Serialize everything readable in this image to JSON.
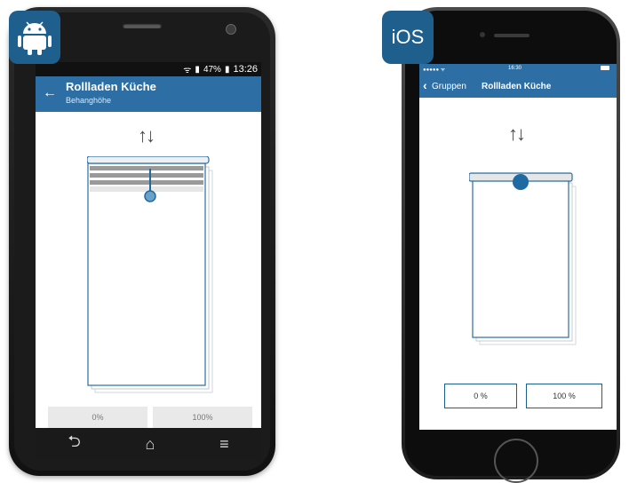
{
  "badges": {
    "android_icon": "android-robot-icon",
    "ios_label": "iOS"
  },
  "android": {
    "status": {
      "battery": "47%",
      "time": "13:26"
    },
    "title": "Rollladen Küche",
    "subtitle": "Behanghöhe",
    "arrows": "↑↓",
    "buttons": {
      "zero": "0%",
      "hundred": "100%"
    },
    "nav_icons": [
      "back-icon",
      "home-icon",
      "menu-icon"
    ],
    "shutter_level": 0.15
  },
  "ios": {
    "status": {
      "carrier": "●●●●● ᯤ",
      "time": "16:30"
    },
    "back_label": "Gruppen",
    "title": "Rollladen Küche",
    "arrows": "↑↓",
    "buttons": {
      "zero": "0 %",
      "hundred": "100 %"
    },
    "shutter_level": 0.0
  },
  "colors": {
    "accent": "#2d6ea4",
    "badge": "#1f5f8e",
    "knob": "#1f6aa2"
  }
}
